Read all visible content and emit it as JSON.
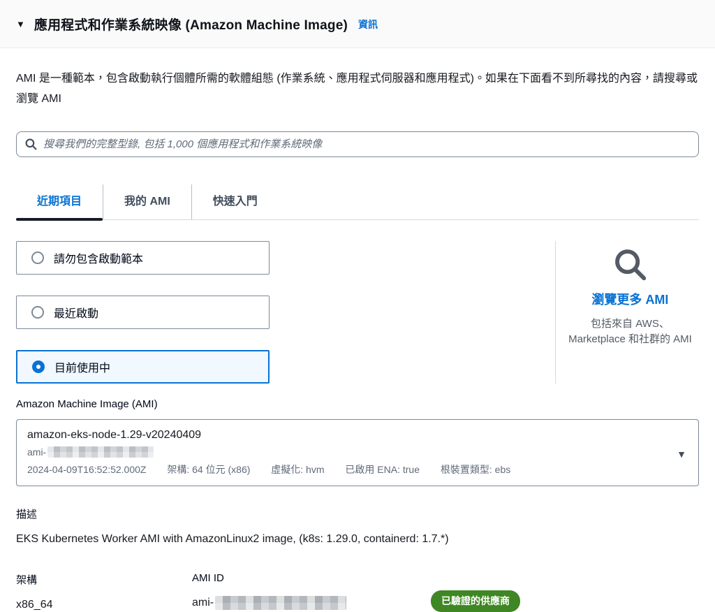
{
  "colors": {
    "accent_link": "#0972d3",
    "active_tab_underline": "#161d26",
    "selected_option_bg": "#f1f8ff",
    "verified_badge_green": "#3f8624",
    "muted_text": "#5f6b7a"
  },
  "header": {
    "collapse_glyph": "▼",
    "title": "應用程式和作業系統映像 (Amazon Machine Image)",
    "info_label": "資訊"
  },
  "intro": "AMI 是一種範本，包含啟動執行個體所需的軟體組態 (作業系統、應用程式伺服器和應用程式)。如果在下面看不到所尋找的內容，請搜尋或瀏覽 AMI",
  "search": {
    "icon": "search-icon",
    "placeholder": "搜尋我們的完整型錄, 包括 1,000 個應用程式和作業系統映像",
    "value": ""
  },
  "tabs": [
    {
      "label": "近期項目",
      "active": true
    },
    {
      "label": "我的 AMI",
      "active": false
    },
    {
      "label": "快速入門",
      "active": false
    }
  ],
  "filters": [
    {
      "label": "請勿包含啟動範本",
      "selected": false
    },
    {
      "label": "最近啟動",
      "selected": false
    },
    {
      "label": "目前使用中",
      "selected": true
    }
  ],
  "browse": {
    "icon": "search-icon-large",
    "link_label": "瀏覽更多 AMI",
    "description": "包括來自 AWS、Marketplace 和社群的 AMI"
  },
  "ami_select": {
    "label": "Amazon Machine Image (AMI)",
    "name": "amazon-eks-node-1.29-v20240409",
    "id_prefix": "ami-",
    "id_redacted": true,
    "meta": [
      "2024-04-09T16:52:52.000Z",
      "架構: 64 位元 (x86)",
      "虛擬化: hvm",
      "已啟用 ENA: true",
      "根裝置類型: ebs"
    ],
    "caret_glyph": "▼"
  },
  "details": {
    "description_label": "描述",
    "description": "EKS Kubernetes Worker AMI with AmazonLinux2 image, (k8s: 1.29.0, containerd: 1.7.*)",
    "architecture_label": "架構",
    "architecture_value": "x86_64",
    "ami_id_label": "AMI ID",
    "ami_id_prefix": "ami-",
    "ami_id_redacted": true,
    "verified_badge": "已驗證的供應商"
  }
}
